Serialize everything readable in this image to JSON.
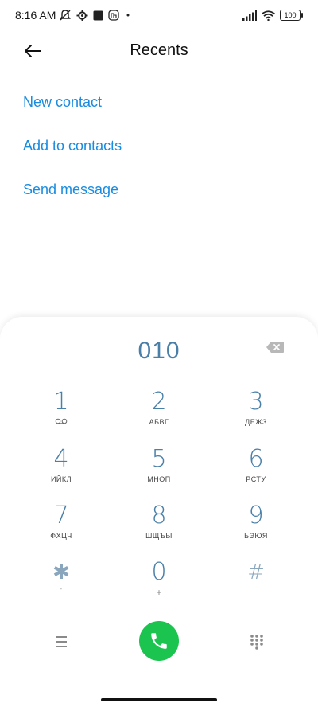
{
  "status_bar": {
    "time": "8:16 AM",
    "battery": "100",
    "icons_left": [
      "muted-notification-icon",
      "settings-gear-icon",
      "square-app-icon",
      "mi-app-icon",
      "dot-icon"
    ],
    "icons_right": [
      "signal-icon",
      "wifi-icon",
      "battery-icon"
    ]
  },
  "header": {
    "title": "Recents",
    "back_icon": "arrow-left-icon"
  },
  "actions": [
    {
      "label": "New contact"
    },
    {
      "label": "Add to contacts"
    },
    {
      "label": "Send message"
    }
  ],
  "dialpad": {
    "number": "010",
    "backspace_icon": "backspace-icon",
    "keys": [
      {
        "digit": "1",
        "sub": "voicemail-icon"
      },
      {
        "digit": "2",
        "sub": "АБВГ"
      },
      {
        "digit": "3",
        "sub": "ДЕЖЗ"
      },
      {
        "digit": "4",
        "sub": "ИЙКЛ"
      },
      {
        "digit": "5",
        "sub": "МНОП"
      },
      {
        "digit": "6",
        "sub": "РСТУ"
      },
      {
        "digit": "7",
        "sub": "ФХЦЧ"
      },
      {
        "digit": "8",
        "sub": "ШЩЪЫ"
      },
      {
        "digit": "9",
        "sub": "ЬЭЮЯ"
      },
      {
        "digit": "✱",
        "sub": "'"
      },
      {
        "digit": "0",
        "sub": "+"
      },
      {
        "digit": "#",
        "sub": ""
      }
    ]
  },
  "bottom_bar": {
    "menu_icon": "menu-icon",
    "call_icon": "phone-icon",
    "dialpad_icon": "dialpad-grid-icon",
    "call_color": "#1ac44f"
  },
  "colors": {
    "accent": "#1a8ce0",
    "digit": "#4a7fa8"
  }
}
